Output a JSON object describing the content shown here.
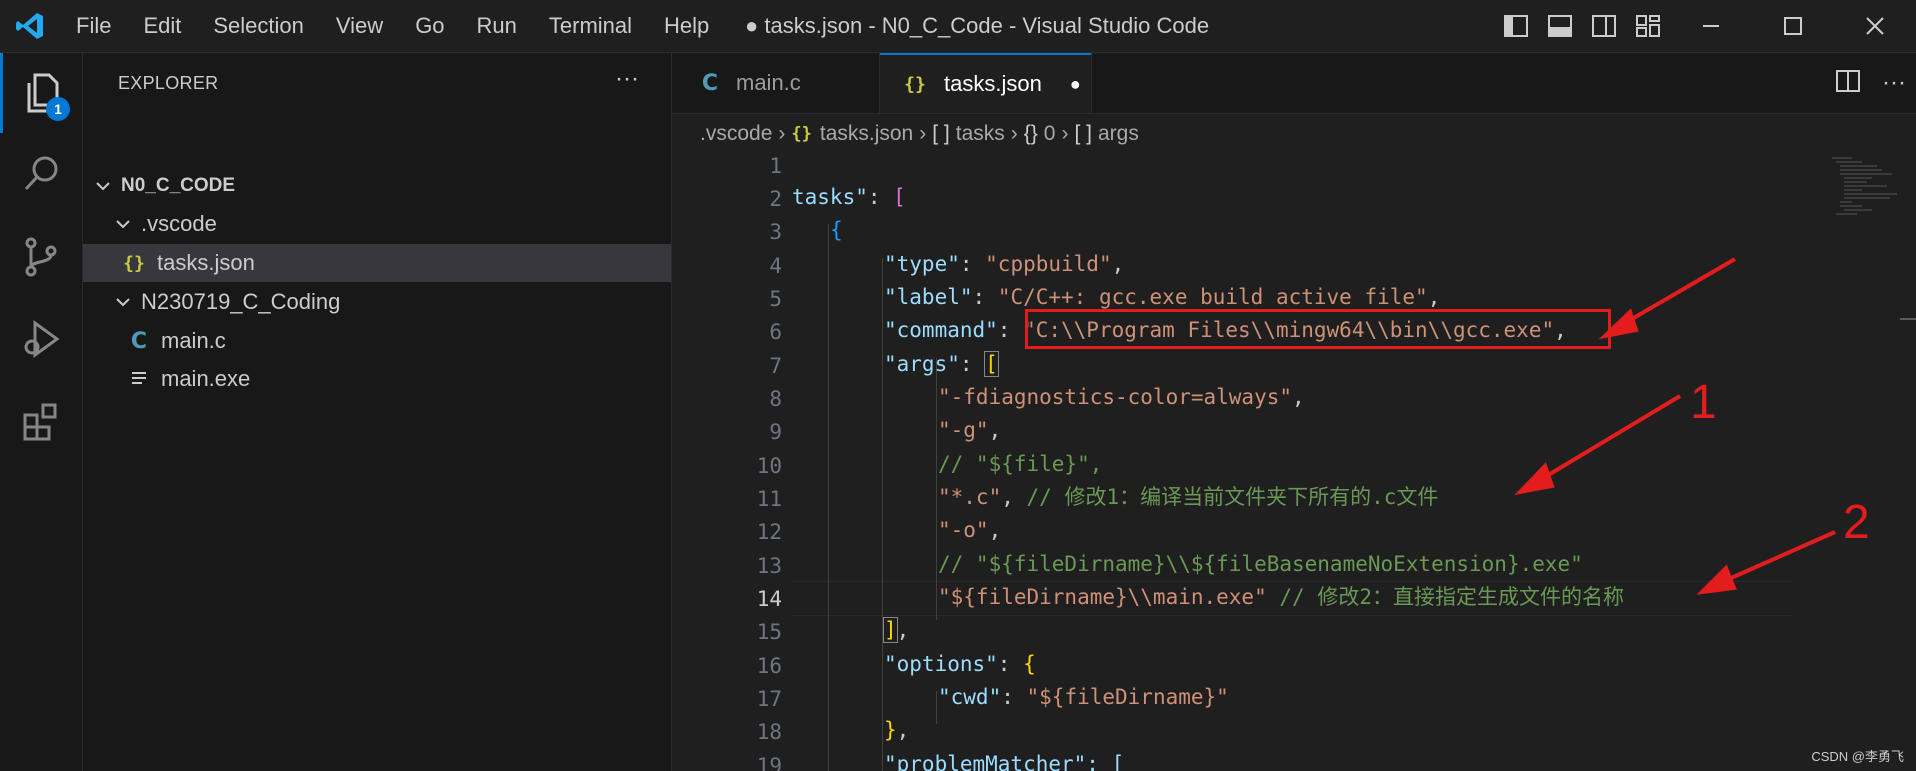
{
  "titlebar": {
    "menu": [
      "File",
      "Edit",
      "Selection",
      "View",
      "Go",
      "Run",
      "Terminal",
      "Help"
    ],
    "title": "● tasks.json - N0_C_Code - Visual Studio Code"
  },
  "activity": {
    "badge": "1"
  },
  "sidebar": {
    "header": "EXPLORER",
    "more": "···",
    "root": "N0_C_CODE",
    "items": [
      {
        "label": ".vscode"
      },
      {
        "label": "tasks.json",
        "icon": "{}"
      },
      {
        "label": "N230719_C_Coding"
      },
      {
        "label": "main.c",
        "icon": "C"
      },
      {
        "label": "main.exe"
      }
    ]
  },
  "tabs": [
    {
      "label": "main.c",
      "icon": "C"
    },
    {
      "label": "tasks.json",
      "icon": "{}",
      "dirty": "●"
    }
  ],
  "breadcrumb": {
    "folder": ".vscode",
    "file": "tasks.json",
    "f_icon": "{}",
    "a_icon": "[ ]",
    "tasks": "tasks",
    "o_icon": "{}",
    "idx": "0",
    "args": "args"
  },
  "editor": {
    "line_numbers": [
      "1",
      "2",
      "3",
      "4",
      "5",
      "6",
      "7",
      "8",
      "9",
      "10",
      "11",
      "12",
      "13",
      "14",
      "15",
      "16",
      "17",
      "18",
      "19"
    ],
    "current_line": "14",
    "code": {
      "l2a": "tasks\"",
      "l2b": ": ",
      "l2c": "[",
      "l3": "{",
      "l4k": "\"type\"",
      "l4v": "\"cppbuild\"",
      "l5k": "\"label\"",
      "l5v": "\"C/C++: gcc.exe build active file\"",
      "l6k": "\"command\"",
      "l6v": "\"C:\\\\Program Files\\\\mingw64\\\\bin\\\\gcc.exe\"",
      "l7k": "\"args\"",
      "l7b": "[",
      "l8": "\"-fdiagnostics-color=always\"",
      "l9": "\"-g\"",
      "l10": "// \"${file}\",",
      "l11s": "\"*.c\"",
      "l11c": "// 修改1：编译当前文件夹下所有的.c文件",
      "l12": "\"-o\"",
      "l13": "// \"${fileDirname}\\\\${fileBasenameNoExtension}.exe\"",
      "l14s": "\"${fileDirname}\\\\main.exe\"",
      "l14c": "// 修改2：直接指定生成文件的名称",
      "l15": "]",
      "l16k": "\"options\"",
      "l16b": "{",
      "l17k": "\"cwd\"",
      "l17v": "\"${fileDirname}\"",
      "l18": "}",
      "l19": "\"problemMatcher\": ["
    }
  },
  "annotations": {
    "one": "1",
    "two": "2"
  },
  "watermark": "CSDN @李勇飞",
  "colors": {
    "accent": "#0078d4",
    "annotation_red": "#e31d1d"
  }
}
